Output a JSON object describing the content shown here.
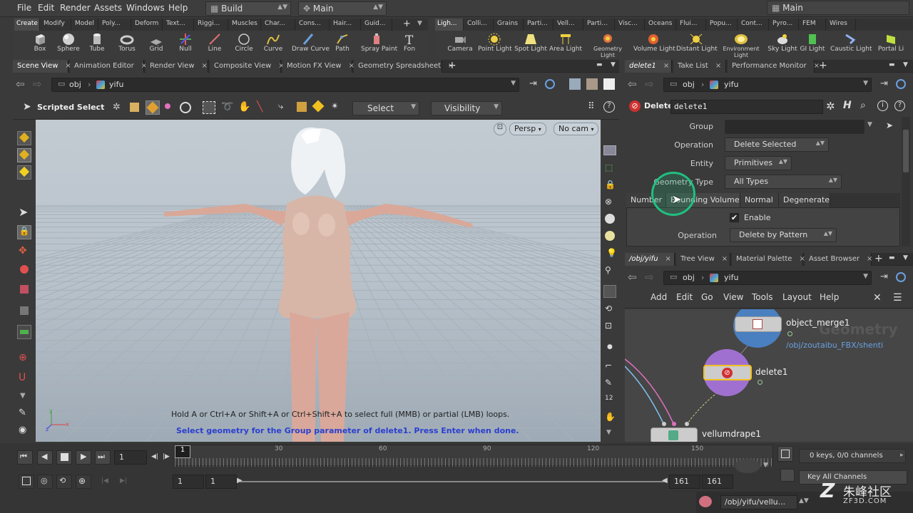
{
  "menubar": {
    "items": [
      "File",
      "Edit",
      "Render",
      "Assets",
      "Windows",
      "Help"
    ],
    "desktop": "Build",
    "context": "Main",
    "right_desktop": "Main"
  },
  "shelf_tabs_left": [
    "Create",
    "Modify",
    "Model",
    "Poly...",
    "Deform",
    "Text...",
    "Riggi...",
    "Muscles",
    "Char...",
    "Cons...",
    "Hair...",
    "Guid..."
  ],
  "shelf_tabs_right": [
    "Ligh...",
    "Colli...",
    "Grains",
    "Parti...",
    "Vell...",
    "Parti...",
    "Visc...",
    "Oceans",
    "Flui...",
    "Popu...",
    "Cont...",
    "Pyro...",
    "FEM",
    "Wires"
  ],
  "shelf_tools_left": [
    "Box",
    "Sphere",
    "Tube",
    "Torus",
    "Grid",
    "Null",
    "Line",
    "Circle",
    "Curve",
    "Draw Curve",
    "Path",
    "Spray Paint",
    "Fon"
  ],
  "shelf_tools_right": [
    "Camera",
    "Point Light",
    "Spot Light",
    "Area Light",
    "Geometry Light",
    "Volume Light",
    "Distant Light",
    "Environment Light",
    "Sky Light",
    "GI Light",
    "Caustic Light",
    "Portal Li"
  ],
  "left_pane": {
    "tabs": [
      "Scene View",
      "Animation Editor",
      "Render View",
      "Composite View",
      "Motion FX View",
      "Geometry Spreadsheet"
    ],
    "path": [
      "obj",
      "yifu"
    ],
    "toolbar": {
      "state_label": "Scripted Select",
      "select_mode": "Select",
      "visibility": "Visibility"
    },
    "viewport": {
      "camera_mode": "Persp",
      "camera": "No cam",
      "hint1": "Hold A or Ctrl+A or Shift+A or Ctrl+Shift+A to select full (MMB) or partial (LMB) loops.",
      "hint2": "Select geometry for the Group parameter of delete1. Press Enter when done.",
      "axis_x": "x",
      "axis_y": "y",
      "axis_z": "z"
    }
  },
  "param_pane": {
    "tabs": [
      "delete1",
      "Take List",
      "Performance Monitor"
    ],
    "path": [
      "obj",
      "yifu"
    ],
    "node_type": "Delete",
    "node_name": "delete1",
    "params": {
      "group_label": "Group",
      "group_value": "",
      "operation_label": "Operation",
      "operation_value": "Delete Selected",
      "entity_label": "Entity",
      "entity_value": "Primitives",
      "geotype_label": "Geometry Type",
      "geotype_value": "All Types"
    },
    "subtabs": [
      "Number",
      "Bounding Volume",
      "Normal",
      "Degenerate"
    ],
    "enable_label": "Enable",
    "enable_checked": true,
    "sub_operation_label": "Operation",
    "sub_operation_value": "Delete by Pattern"
  },
  "network_pane": {
    "tabs": [
      "/obj/yifu",
      "Tree View",
      "Material Palette",
      "Asset Browser"
    ],
    "path": [
      "obj",
      "yifu"
    ],
    "menu": [
      "Add",
      "Edit",
      "Go",
      "View",
      "Tools",
      "Layout",
      "Help"
    ],
    "watermark": "Geometry",
    "nodes": [
      {
        "name": "object_merge1",
        "sub": "/obj/zoutaibu_FBX/shenti"
      },
      {
        "name": "delete1",
        "sub": ""
      },
      {
        "name": "vellumdrape1",
        "sub": ""
      }
    ]
  },
  "timeline": {
    "current_frame": "1",
    "ticks": [
      "30",
      "60",
      "90",
      "120",
      "150"
    ],
    "marker": "1",
    "range_start": "1",
    "range_start2": "1",
    "range_end": "161",
    "range_end2": "161",
    "keys_info": "0 keys, 0/0 channels",
    "key_all": "Key All Channels",
    "status_path": "/obj/yifu/vellu..."
  },
  "watermark_logo": {
    "cn": "朱峰社区",
    "url": "ZF3D.COM"
  },
  "colors": {
    "accent": "#f0c020",
    "node_purple": "#a070d0",
    "node_blue": "#4a7fc0",
    "cursor_ring": "#20c080",
    "hint_blue": "#2b3fd0"
  }
}
